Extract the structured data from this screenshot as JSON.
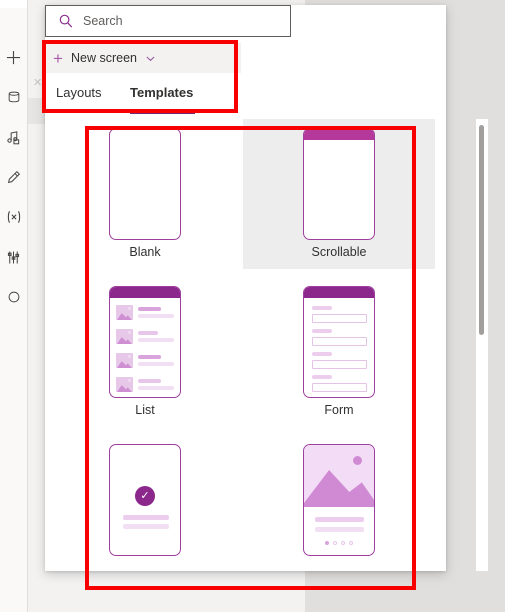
{
  "app": {
    "background_color": "#e1dfdd",
    "canvas_color": "#f3f2f1",
    "accent_color": "#742774",
    "annotation_color": "#f90000"
  },
  "left_rail": {
    "items": [
      {
        "name": "insert",
        "icon": "plus-icon"
      },
      {
        "name": "data",
        "icon": "database-icon"
      },
      {
        "name": "media",
        "icon": "media-icon"
      },
      {
        "name": "theme",
        "icon": "paintbrush-icon"
      },
      {
        "name": "variables",
        "icon": "variables-icon"
      },
      {
        "name": "advanced-tools",
        "icon": "tools-icon"
      },
      {
        "name": "components",
        "icon": "circle-icon"
      }
    ]
  },
  "search": {
    "placeholder": "Search",
    "value": "",
    "icon": "search-icon"
  },
  "new_screen": {
    "label": "New screen",
    "plus_icon": "plus-icon",
    "chevron_icon": "chevron-down-icon"
  },
  "tabs": {
    "items": [
      {
        "label": "Layouts",
        "selected": false
      },
      {
        "label": "Templates",
        "selected": true
      }
    ]
  },
  "templates": [
    {
      "label": "Blank",
      "kind": "blank",
      "hover": false
    },
    {
      "label": "Scrollable",
      "kind": "scrollable",
      "hover": true
    },
    {
      "label": "List",
      "kind": "list",
      "hover": false
    },
    {
      "label": "Form",
      "kind": "form",
      "hover": false
    },
    {
      "label": "",
      "kind": "success",
      "hover": false
    },
    {
      "label": "",
      "kind": "media",
      "hover": false
    }
  ],
  "scrollbar": {
    "name": "templates-scrollbar",
    "thumb_color": "#a19f9d"
  },
  "annotations": [
    {
      "name": "new-screen-tabs-highlight",
      "color": "#f90000"
    },
    {
      "name": "template-grid-highlight",
      "color": "#f90000"
    }
  ]
}
